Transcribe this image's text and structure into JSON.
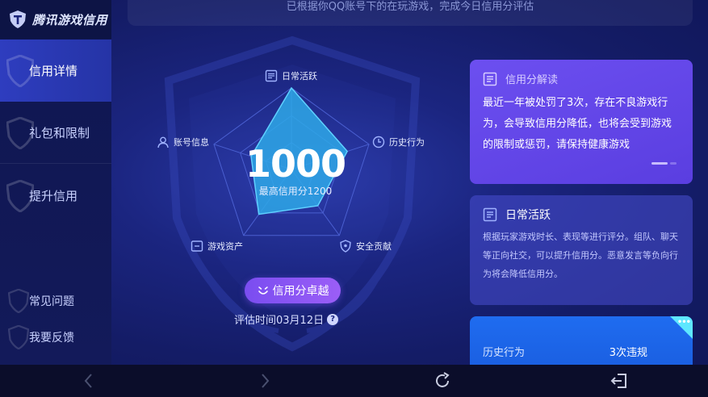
{
  "app": {
    "title": "腾讯游戏信用"
  },
  "sidebar": {
    "items": [
      {
        "label": "信用详情",
        "active": true
      },
      {
        "label": "礼包和限制",
        "active": false
      },
      {
        "label": "提升信用",
        "active": false
      }
    ],
    "footer": [
      {
        "label": "常见问题"
      },
      {
        "label": "我要反馈"
      }
    ]
  },
  "banner": {
    "text": "已根据你QQ账号下的在玩游戏，完成今日信用分评估"
  },
  "radar": {
    "axes": [
      {
        "label": "日常活跃",
        "icon": "document-icon"
      },
      {
        "label": "历史行为",
        "icon": "clock-icon"
      },
      {
        "label": "安全贡献",
        "icon": "shield-icon"
      },
      {
        "label": "游戏资产",
        "icon": "box-icon"
      },
      {
        "label": "账号信息",
        "icon": "user-icon"
      }
    ],
    "values": [
      1.0,
      0.72,
      0.55,
      0.68,
      0.52
    ],
    "fill_color": "#2ea8e8",
    "grid_color": "#4a5fd0"
  },
  "score": {
    "value": "1000",
    "max_label": "最高信用分1200"
  },
  "badge": {
    "label": "信用分卓越",
    "icon": "smile-icon"
  },
  "eval": {
    "label": "评估时间03月12日",
    "help": "?"
  },
  "cards": {
    "interpret": {
      "title": "信用分解读",
      "body": "最近一年被处罚了3次，存在不良游戏行为，会导致信用分降低，也将会受到游戏的限制或惩罚，请保持健康游戏"
    },
    "daily": {
      "title": "日常活跃",
      "body": "根据玩家游戏时长、表现等进行评分。组队、聊天等正向社交，可以提升信用分。恶意发言等负向行为将会降低信用分。"
    },
    "history": {
      "key": "历史行为",
      "value": "3次违规",
      "corner": "•••"
    }
  },
  "colors": {
    "accent": "#7a4df0",
    "card_purple": "#6c4ff0",
    "card_blue": "#1f6cf0",
    "sidebar_active": "#2e3dbf"
  }
}
